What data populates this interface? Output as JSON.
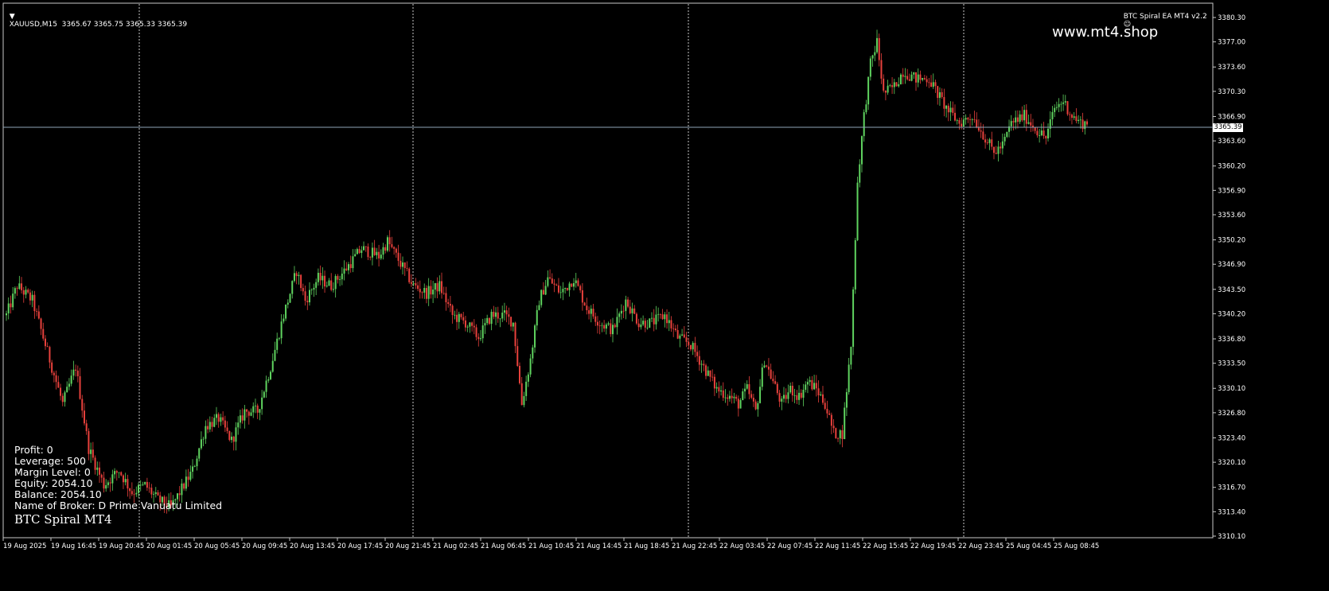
{
  "header": {
    "symbol_line": "XAUUSD,M15  3365.67 3365.75 3365.33 3365.39",
    "ea_name": "BTC Spiral EA MT4 v2.2",
    "smiley_icon": "smiley-face-icon",
    "dropdown_icon": "triangle-down-icon"
  },
  "watermark": "www.mt4.shop",
  "current_price": "3365.39",
  "account": {
    "profit": "Profit: 0",
    "leverage": "Leverage: 500",
    "margin_level": "Margin Level: 0",
    "equity": "Equity: 2054.10",
    "balance": "Balance: 2054.10",
    "broker": "Name of Broker: D Prime Vanuatu Limited",
    "title": "BTC Spiral MT4"
  },
  "colors": {
    "background": "#000000",
    "bull": "#5fd35f",
    "bear": "#e8413c",
    "grid": "#c0c0c0",
    "price_line": "#8fa3b8"
  },
  "chart_data": {
    "type": "candlestick",
    "symbol": "XAUUSD",
    "timeframe": "M15",
    "y_ticks": [
      "3380.30",
      "3377.00",
      "3373.60",
      "3370.30",
      "3366.90",
      "3363.60",
      "3360.20",
      "3356.90",
      "3353.60",
      "3350.20",
      "3346.90",
      "3343.50",
      "3340.20",
      "3336.80",
      "3333.50",
      "3330.10",
      "3326.80",
      "3323.40",
      "3320.10",
      "3316.70",
      "3313.40",
      "3310.10"
    ],
    "ylim": [
      3310.1,
      3380.3
    ],
    "x_ticks": [
      "19 Aug 2025",
      "19 Aug 16:45",
      "19 Aug 20:45",
      "20 Aug 01:45",
      "20 Aug 05:45",
      "20 Aug 09:45",
      "20 Aug 13:45",
      "20 Aug 17:45",
      "20 Aug 21:45",
      "21 Aug 02:45",
      "21 Aug 06:45",
      "21 Aug 10:45",
      "21 Aug 14:45",
      "21 Aug 18:45",
      "21 Aug 22:45",
      "22 Aug 03:45",
      "22 Aug 07:45",
      "22 Aug 11:45",
      "22 Aug 15:45",
      "22 Aug 19:45",
      "22 Aug 23:45",
      "25 Aug 04:45",
      "25 Aug 08:45"
    ],
    "close_path": [
      [
        0,
        3340
      ],
      [
        5,
        3344
      ],
      [
        12,
        3342
      ],
      [
        20,
        3334
      ],
      [
        26,
        3328
      ],
      [
        32,
        3333
      ],
      [
        38,
        3322
      ],
      [
        45,
        3317
      ],
      [
        52,
        3319
      ],
      [
        58,
        3316
      ],
      [
        64,
        3317
      ],
      [
        70,
        3315
      ],
      [
        76,
        3314
      ],
      [
        80,
        3316
      ],
      [
        86,
        3319
      ],
      [
        92,
        3325
      ],
      [
        98,
        3326
      ],
      [
        104,
        3323
      ],
      [
        110,
        3327
      ],
      [
        116,
        3327
      ],
      [
        122,
        3333
      ],
      [
        128,
        3340
      ],
      [
        134,
        3346
      ],
      [
        138,
        3342
      ],
      [
        144,
        3345
      ],
      [
        150,
        3344
      ],
      [
        156,
        3346
      ],
      [
        164,
        3349
      ],
      [
        172,
        3348
      ],
      [
        176,
        3350
      ],
      [
        182,
        3347
      ],
      [
        188,
        3344
      ],
      [
        194,
        3343
      ],
      [
        200,
        3344
      ],
      [
        206,
        3340
      ],
      [
        212,
        3339
      ],
      [
        218,
        3337
      ],
      [
        224,
        3340
      ],
      [
        230,
        3340
      ],
      [
        234,
        3339
      ],
      [
        238,
        3328
      ],
      [
        242,
        3334
      ],
      [
        246,
        3342
      ],
      [
        250,
        3345
      ],
      [
        256,
        3343
      ],
      [
        262,
        3345
      ],
      [
        268,
        3341
      ],
      [
        274,
        3339
      ],
      [
        280,
        3338
      ],
      [
        286,
        3342
      ],
      [
        292,
        3339
      ],
      [
        298,
        3339
      ],
      [
        304,
        3340
      ],
      [
        310,
        3337
      ],
      [
        316,
        3336
      ],
      [
        322,
        3333
      ],
      [
        328,
        3330
      ],
      [
        334,
        3329
      ],
      [
        338,
        3328
      ],
      [
        342,
        3330
      ],
      [
        346,
        3327
      ],
      [
        350,
        3334
      ],
      [
        354,
        3331
      ],
      [
        358,
        3328
      ],
      [
        362,
        3330
      ],
      [
        366,
        3329
      ],
      [
        370,
        3331
      ],
      [
        374,
        3330
      ],
      [
        378,
        3328
      ],
      [
        382,
        3324
      ],
      [
        386,
        3324
      ],
      [
        390,
        3336
      ],
      [
        393,
        3358
      ],
      [
        396,
        3367
      ],
      [
        399,
        3374
      ],
      [
        402,
        3377
      ],
      [
        405,
        3370
      ],
      [
        410,
        3371
      ],
      [
        414,
        3373
      ],
      [
        420,
        3372
      ],
      [
        426,
        3372
      ],
      [
        430,
        3370
      ],
      [
        434,
        3368
      ],
      [
        440,
        3366
      ],
      [
        446,
        3367
      ],
      [
        452,
        3364
      ],
      [
        456,
        3362
      ],
      [
        460,
        3363
      ],
      [
        464,
        3366
      ],
      [
        470,
        3367
      ],
      [
        476,
        3365
      ],
      [
        480,
        3364
      ],
      [
        484,
        3368
      ],
      [
        488,
        3369
      ],
      [
        492,
        3367
      ],
      [
        496,
        3366
      ]
    ]
  }
}
